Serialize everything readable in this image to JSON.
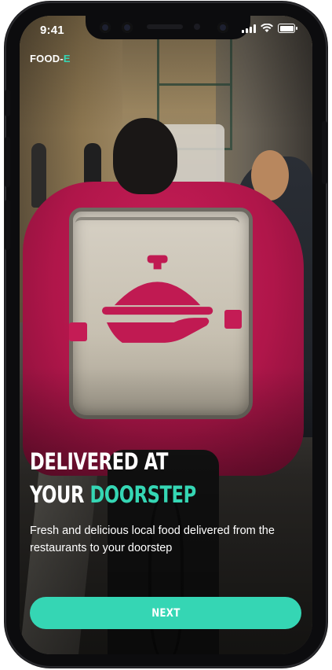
{
  "status_bar": {
    "time": "9:41",
    "icons": [
      "signal-icon",
      "wifi-icon",
      "battery-icon"
    ]
  },
  "brand": {
    "name_main": "FOOD-",
    "name_accent": "E"
  },
  "hero": {
    "line1": "DELIVERED AT",
    "line2_main": "YOUR ",
    "line2_accent": "DOORSTEP",
    "subtitle": "Fresh and delicious local food delivered from the restaurants to your doorstep"
  },
  "actions": {
    "next_label": "NEXT"
  },
  "colors": {
    "accent": "#35d6b4",
    "jacket": "#c01a52",
    "text": "#ffffff"
  }
}
